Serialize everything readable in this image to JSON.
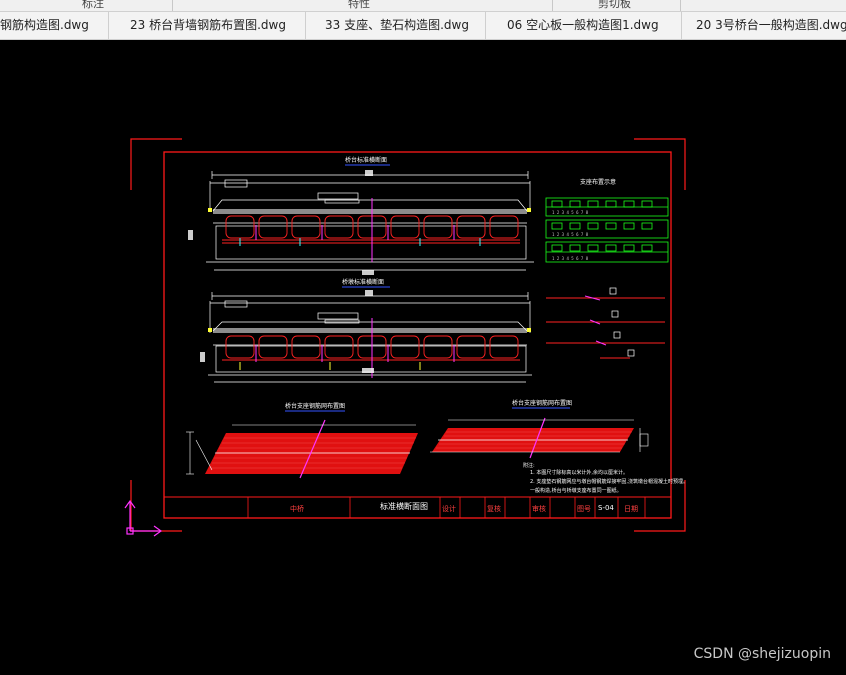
{
  "ribbon": {
    "labels": [
      "标注",
      "特性",
      "剪切板"
    ]
  },
  "tabs": [
    "钢筋构造图.dwg",
    "23 桥台背墙钢筋布置图.dwg",
    "33 支座、垫石构造图.dwg",
    "06 空心板一般构造图1.dwg",
    "20 3号桥台一般构造图.dwg"
  ],
  "drawing": {
    "section_title_1": "桥台标准横断面",
    "section_title_2": "桥墩标准横断面",
    "layout_title": "支座布置示意",
    "plan_title_1": "桥台支座钢筋网布置图",
    "plan_title_2": "桥台支座钢筋网布置图",
    "notes_heading": "附注:",
    "notes": [
      "1. 本图尺寸除标高以米计外,余均以厘米计。",
      "2. 支座垫石钢筋网应与墩台帽钢筋焊接牢固,浇筑墩台帽混凝土时预埋。",
      "一般构造,桥台与桥墩支座布置同一图纸。"
    ],
    "title_block": {
      "project": "中桥",
      "drawing_name": "标准横断面图",
      "design": "设计",
      "review": "复核",
      "approve": "审核",
      "fig_no_label": "图号",
      "fig_no": "S-04",
      "date_label": "日期"
    }
  },
  "colors": {
    "frame_red": "#ff1a1a",
    "frame_white": "#ffffff",
    "green": "#1aff1a",
    "magenta": "#ff33ff",
    "yellow": "#ffff33",
    "blue": "#3355ff",
    "cyan": "#33ffff"
  },
  "watermark": "CSDN @shejizuopin"
}
